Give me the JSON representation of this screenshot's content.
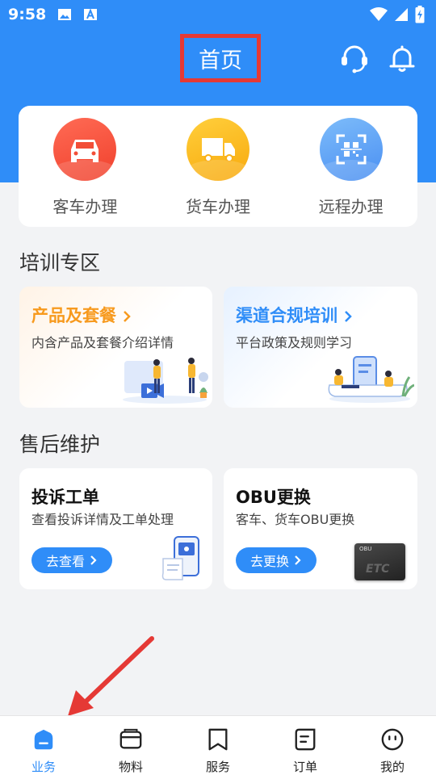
{
  "status_bar": {
    "time": "9:58"
  },
  "header": {
    "title": "首页"
  },
  "quick_actions": [
    {
      "label": "客车办理",
      "icon": "car-icon"
    },
    {
      "label": "货车办理",
      "icon": "truck-icon"
    },
    {
      "label": "远程办理",
      "icon": "qr-scan-icon"
    }
  ],
  "training": {
    "title": "培训专区",
    "cards": [
      {
        "title": "产品及套餐",
        "subtitle": "内含产品及套餐介绍详情",
        "color": "#f79a1e"
      },
      {
        "title": "渠道合规培训",
        "subtitle": "平台政策及规则学习",
        "color": "#2f8df8"
      }
    ]
  },
  "aftersales": {
    "title": "售后维护",
    "cards": [
      {
        "title": "投诉工单",
        "subtitle": "查看投诉详情及工单处理",
        "button": "去查看"
      },
      {
        "title": "OBU更换",
        "subtitle": "客车、货车OBU更换",
        "button": "去更换"
      }
    ]
  },
  "etc_label": "ETC",
  "obu_label": "OBU",
  "nav": [
    {
      "label": "业务",
      "icon": "home-icon",
      "active": true
    },
    {
      "label": "物料",
      "icon": "wallet-icon"
    },
    {
      "label": "服务",
      "icon": "bookmark-icon"
    },
    {
      "label": "订单",
      "icon": "order-icon"
    },
    {
      "label": "我的",
      "icon": "profile-icon"
    }
  ],
  "colors": {
    "primary": "#2f8df8",
    "highlight": "#e53935"
  }
}
